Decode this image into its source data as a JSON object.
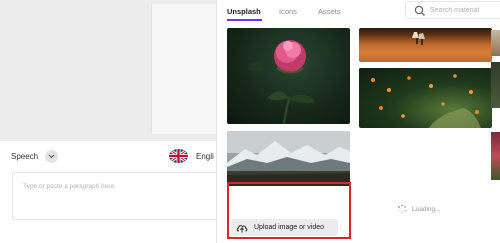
{
  "editor": {
    "speech_label": "Speech",
    "language_label": "Engli",
    "paragraph_placeholder": "Type or paste a paragraph here."
  },
  "panel": {
    "tabs": [
      {
        "label": "Unsplash",
        "active": true
      },
      {
        "label": "Icons",
        "active": false
      },
      {
        "label": "Assets",
        "active": false
      }
    ],
    "search_placeholder": "Search material",
    "loading_text": "Loading...",
    "upload_label": "Upload image or video"
  },
  "colors": {
    "accent": "#7b2cff",
    "highlight": "#d9262e",
    "upload_bg": "#ececec"
  }
}
